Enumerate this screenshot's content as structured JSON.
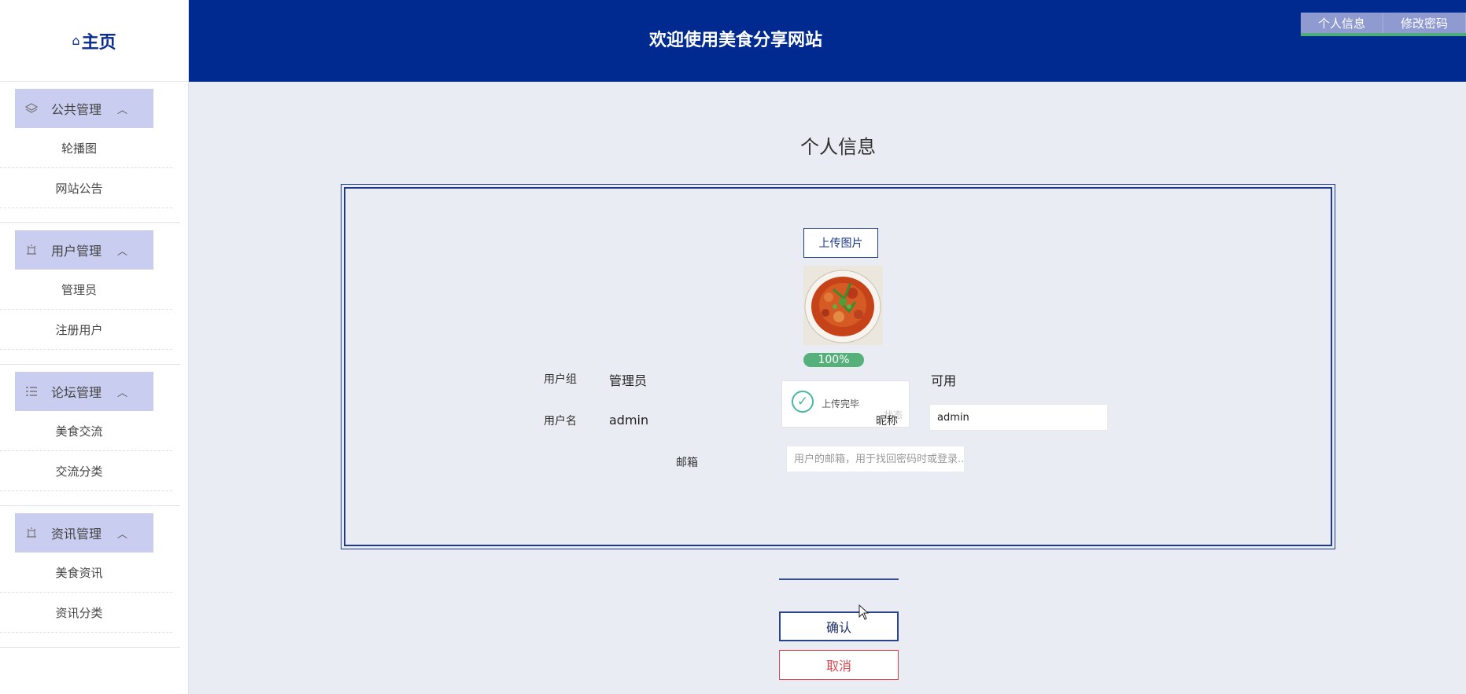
{
  "sidebar": {
    "logo": {
      "icon": "home-icon",
      "label": "主页"
    },
    "groups": [
      {
        "title": "公共管理",
        "icon": "layers-icon",
        "items": [
          "轮播图",
          "网站公告"
        ]
      },
      {
        "title": "用户管理",
        "icon": "alarm-icon",
        "items": [
          "管理员",
          "注册用户"
        ]
      },
      {
        "title": "论坛管理",
        "icon": "list-icon",
        "items": [
          "美食交流",
          "交流分类"
        ]
      },
      {
        "title": "资讯管理",
        "icon": "alarm-icon",
        "items": [
          "美食资讯",
          "资讯分类"
        ]
      }
    ]
  },
  "header": {
    "title": "欢迎使用美食分享网站",
    "tabs": [
      "个人信息",
      "修改密码"
    ]
  },
  "main": {
    "title": "个人信息",
    "upload_button": "上传图片",
    "upload_progress": "100%",
    "toast": {
      "message": "上传完毕",
      "status": "状态"
    },
    "fields": {
      "user_group_label": "用户组",
      "user_group_value": "管理员",
      "status_value": "可用",
      "username_label": "用户名",
      "username_value": "admin",
      "nickname_label": "昵称",
      "nickname_value": "admin",
      "email_label": "邮箱",
      "email_placeholder": "用户的邮箱，用于找回密码时或登录..."
    },
    "confirm_button": "确认",
    "cancel_button": "取消"
  },
  "colors": {
    "header_bg": "#002a8f",
    "sidebar_group_bg": "#c9cdf0",
    "progress_green": "#56b07a",
    "cancel_red": "#d9474f"
  }
}
